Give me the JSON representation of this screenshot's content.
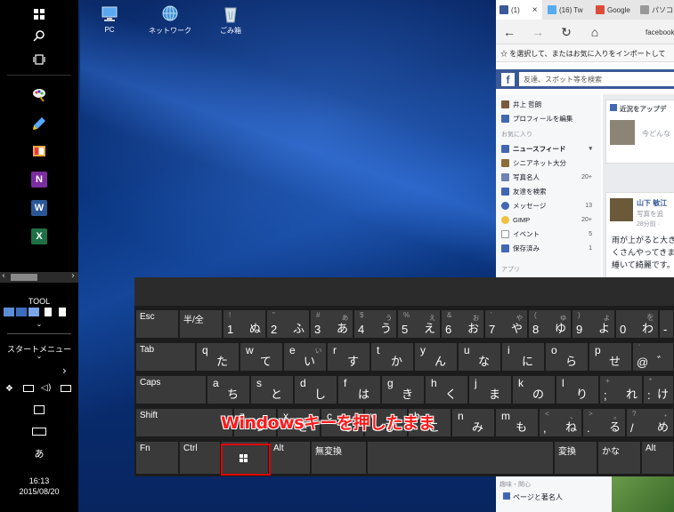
{
  "desktop_icons": [
    {
      "label": "PC"
    },
    {
      "label": "ネットワーク"
    },
    {
      "label": "ごみ箱"
    }
  ],
  "startbar": {
    "tool_label": "TOOL",
    "start_menu_label": "スタートメニュー",
    "ime_label": "あ",
    "clock_time": "16:13",
    "clock_date": "2015/08/20",
    "apps": [
      {
        "icon": "paint-icon"
      },
      {
        "icon": "notepad-icon"
      },
      {
        "icon": "bookshelf-icon"
      },
      {
        "icon": "onenote-icon",
        "letter": "N",
        "color": "#7b2c9e"
      },
      {
        "icon": "word-icon",
        "letter": "W",
        "color": "#2b5797"
      },
      {
        "icon": "excel-icon",
        "letter": "X",
        "color": "#1e7145"
      }
    ]
  },
  "browser": {
    "tabs": [
      {
        "label": "(1)",
        "close": "×",
        "color": "#3b5998"
      },
      {
        "label": "(16) Tw",
        "color": "#55acee"
      },
      {
        "label": "Google",
        "color": "#dd4b39"
      },
      {
        "label": "パソコ",
        "color": "#999999"
      }
    ],
    "url": "facebook",
    "favorites_hint": "☆ を選択して、またはお気に入りをインポートして",
    "fb_search_placeholder": "友達、スポット等を検索",
    "profile_name": "井上 哲朗",
    "edit_profile": "プロフィールを編集",
    "favorites_header": "お気に入り",
    "left_items": [
      {
        "label": "ニュースフィード",
        "count": "▾",
        "bold": true,
        "color": "#4267b2"
      },
      {
        "label": "シニアネット大分",
        "count": "",
        "color": "#8a6d3b"
      },
      {
        "label": "写真名人",
        "count": "20+",
        "color": "#6d84b4"
      },
      {
        "label": "友達を検索",
        "count": "",
        "color": "#4267b2"
      },
      {
        "label": "メッセージ",
        "count": "13",
        "color": "#4267b2"
      },
      {
        "label": "GIMP",
        "count": "20+",
        "color": "#f0c040"
      },
      {
        "label": "イベント",
        "count": "5",
        "color": "#ffffff"
      },
      {
        "label": "保存済み",
        "count": "1",
        "color": "#4267b2"
      }
    ],
    "apps_header": "アプリ",
    "right_header": "近況をアップデ",
    "status_placeholder": "今どんな",
    "post_author": "山下 敏江",
    "post_sub": "写真を追",
    "post_time": "28分前 · ",
    "post_text": [
      "雨が上がると大き",
      "くさんやってきま",
      "綞いて綺麗です。"
    ],
    "bottom_header": "趣味・関心",
    "bottom_item": "ページと著名人"
  },
  "keyboard": {
    "rows": [
      [
        {
          "main": "Esc"
        },
        {
          "main": "半/全"
        },
        {
          "shift": "!",
          "bottom": "1",
          "kana": "ぬ"
        },
        {
          "shift": "\"",
          "bottom": "2",
          "kana": "ふ"
        },
        {
          "shift": "#",
          "shiftkana": "ぁ",
          "bottom": "3",
          "kana": "あ"
        },
        {
          "shift": "$",
          "shiftkana": "ぅ",
          "bottom": "4",
          "kana": "う"
        },
        {
          "shift": "%",
          "shiftkana": "ぇ",
          "bottom": "5",
          "kana": "え"
        },
        {
          "shift": "&",
          "shiftkana": "ぉ",
          "bottom": "6",
          "kana": "お"
        },
        {
          "shift": "'",
          "shiftkana": "ゃ",
          "bottom": "7",
          "kana": "や"
        },
        {
          "shift": "(",
          "shiftkana": "ゅ",
          "bottom": "8",
          "kana": "ゆ"
        },
        {
          "shift": ")",
          "shiftkana": "ょ",
          "bottom": "9",
          "kana": "よ"
        },
        {
          "shift": "",
          "shiftkana": "を",
          "bottom": "0",
          "kana": "わ"
        },
        {
          "shift": "=",
          "bottom": "-",
          "kana": "ほ"
        }
      ],
      [
        {
          "main": "Tab"
        },
        {
          "bottom": "q",
          "kana": "た"
        },
        {
          "bottom": "w",
          "kana": "て"
        },
        {
          "shift": "e",
          "shiftkana": "ぃ",
          "kana": "い"
        },
        {
          "bottom": "r",
          "kana": "す"
        },
        {
          "bottom": "t",
          "kana": "か"
        },
        {
          "bottom": "y",
          "kana": "ん"
        },
        {
          "bottom": "u",
          "kana": "な"
        },
        {
          "bottom": "i",
          "kana": "に"
        },
        {
          "bottom": "o",
          "kana": "ら"
        },
        {
          "bottom": "p",
          "kana": "せ"
        },
        {
          "shift": "`",
          "bottom": "@",
          "kana": "゛"
        }
      ],
      [
        {
          "main": "Caps"
        },
        {
          "bottom": "a",
          "kana": "ち"
        },
        {
          "bottom": "s",
          "kana": "と"
        },
        {
          "bottom": "d",
          "kana": "し"
        },
        {
          "bottom": "f",
          "kana": "は"
        },
        {
          "bottom": "g",
          "kana": "き"
        },
        {
          "bottom": "h",
          "kana": "く"
        },
        {
          "bottom": "j",
          "kana": "ま"
        },
        {
          "bottom": "k",
          "kana": "の"
        },
        {
          "bottom": "l",
          "kana": "り"
        },
        {
          "shift": "+",
          "bottom": ";",
          "kana": "れ"
        },
        {
          "shift": "*",
          "bottom": ":",
          "kana": "け"
        }
      ],
      [
        {
          "main": "Shift"
        },
        {
          "bottom": "z",
          "kana": "つ"
        },
        {
          "bottom": "x",
          "kana": "さ"
        },
        {
          "bottom": "c",
          "kana": "そ"
        },
        {
          "bottom": "v",
          "kana": "ひ"
        },
        {
          "bottom": "b",
          "kana": "こ"
        },
        {
          "bottom": "n",
          "kana": "み"
        },
        {
          "bottom": "m",
          "kana": "も"
        },
        {
          "shift": "<",
          "shiftkana": "、",
          "bottom": ",",
          "kana": "ね"
        },
        {
          "shift": ">",
          "shiftkana": "。",
          "bottom": ".",
          "kana": "る"
        },
        {
          "shift": "?",
          "shiftkana": "・",
          "bottom": "/",
          "kana": "め"
        }
      ],
      [
        {
          "main": "Fn"
        },
        {
          "main": "Ctrl"
        },
        {
          "main": ""
        },
        {
          "main": "Alt"
        },
        {
          "main": "無変換"
        },
        {
          "main": ""
        },
        {
          "main": "変換"
        },
        {
          "main": "かな"
        },
        {
          "main": "Alt"
        }
      ]
    ]
  },
  "caption": "Windowsキーを押したまま",
  "colors": {
    "highlight": "#e00000",
    "facebook": "#3b5998"
  }
}
